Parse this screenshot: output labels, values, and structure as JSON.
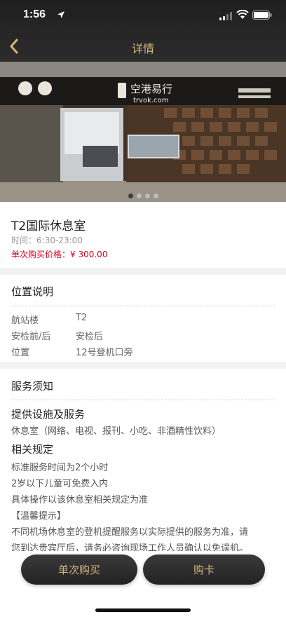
{
  "status_bar": {
    "time": "1:56"
  },
  "nav": {
    "title": "详情"
  },
  "hero": {
    "sign_text": "空港易行",
    "sign_url": "trvok.com",
    "slides": 4,
    "active_slide": 0
  },
  "lounge": {
    "name": "T2国际休息室",
    "hours_label": "时间：",
    "hours": "6:30-23:00",
    "price_label": "单次购买价格：",
    "price": "¥ 300.00"
  },
  "location": {
    "title": "位置说明",
    "rows": [
      {
        "key": "航站楼",
        "value": "T2"
      },
      {
        "key": "安检前/后",
        "value": "安检后"
      },
      {
        "key": "位置",
        "value": "12号登机口旁"
      }
    ]
  },
  "service": {
    "title": "服务须知",
    "facilities_title": "提供设施及服务",
    "facilities": "休息室（网络、电视、报刊、小吃、非酒精性饮料）",
    "rules_title": "相关规定",
    "rules": [
      "标准服务时间为2个小时",
      "2岁以下儿童可免费入内",
      "具体操作以该休息室相关规定为准",
      "【温馨提示】",
      "不同机场休息室的登机提醒服务以实际提供的服务为准，请",
      "您到达贵宾厅后，请务必咨询现场工作人员确认以免误机。"
    ]
  },
  "buttons": {
    "single": "单次购买",
    "card": "购卡"
  },
  "colors": {
    "gold": "#d8b479",
    "price_red": "#d0021b",
    "dark": "#222222"
  }
}
